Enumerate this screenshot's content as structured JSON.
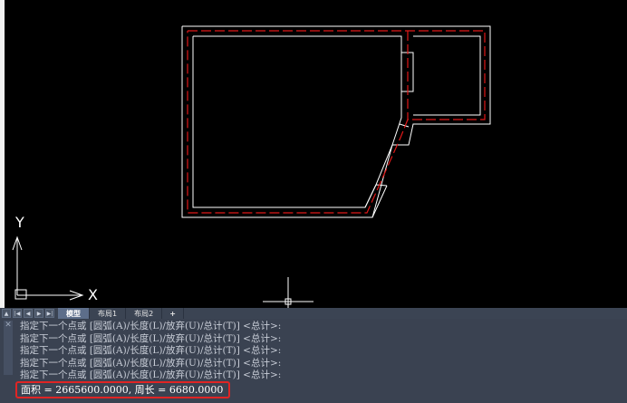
{
  "viewport": {
    "ucs": {
      "y_label": "Y",
      "x_label": "X"
    }
  },
  "layout_tabs": {
    "nav_buttons": [
      "▲",
      "|◀",
      "◀",
      "▶",
      "▶|"
    ],
    "tabs": [
      "模型",
      "布局1",
      "布局2",
      "+"
    ],
    "active_tab": "模型"
  },
  "command_line": {
    "history": [
      "指定下一个点或 [圆弧(A)/长度(L)/放弃(U)/总计(T)] <总计>:",
      "指定下一个点或 [圆弧(A)/长度(L)/放弃(U)/总计(T)] <总计>:",
      "指定下一个点或 [圆弧(A)/长度(L)/放弃(U)/总计(T)] <总计>:",
      "指定下一个点或 [圆弧(A)/长度(L)/放弃(U)/总计(T)] <总计>:",
      "指定下一个点或 [圆弧(A)/长度(L)/放弃(U)/总计(T)] <总计>:"
    ],
    "result": "面积 = 2665600.0000, 周长 = 6680.0000"
  },
  "colors": {
    "wall": "#ffffff",
    "centerline": "#e01818",
    "highlight_box": "#e02424"
  }
}
